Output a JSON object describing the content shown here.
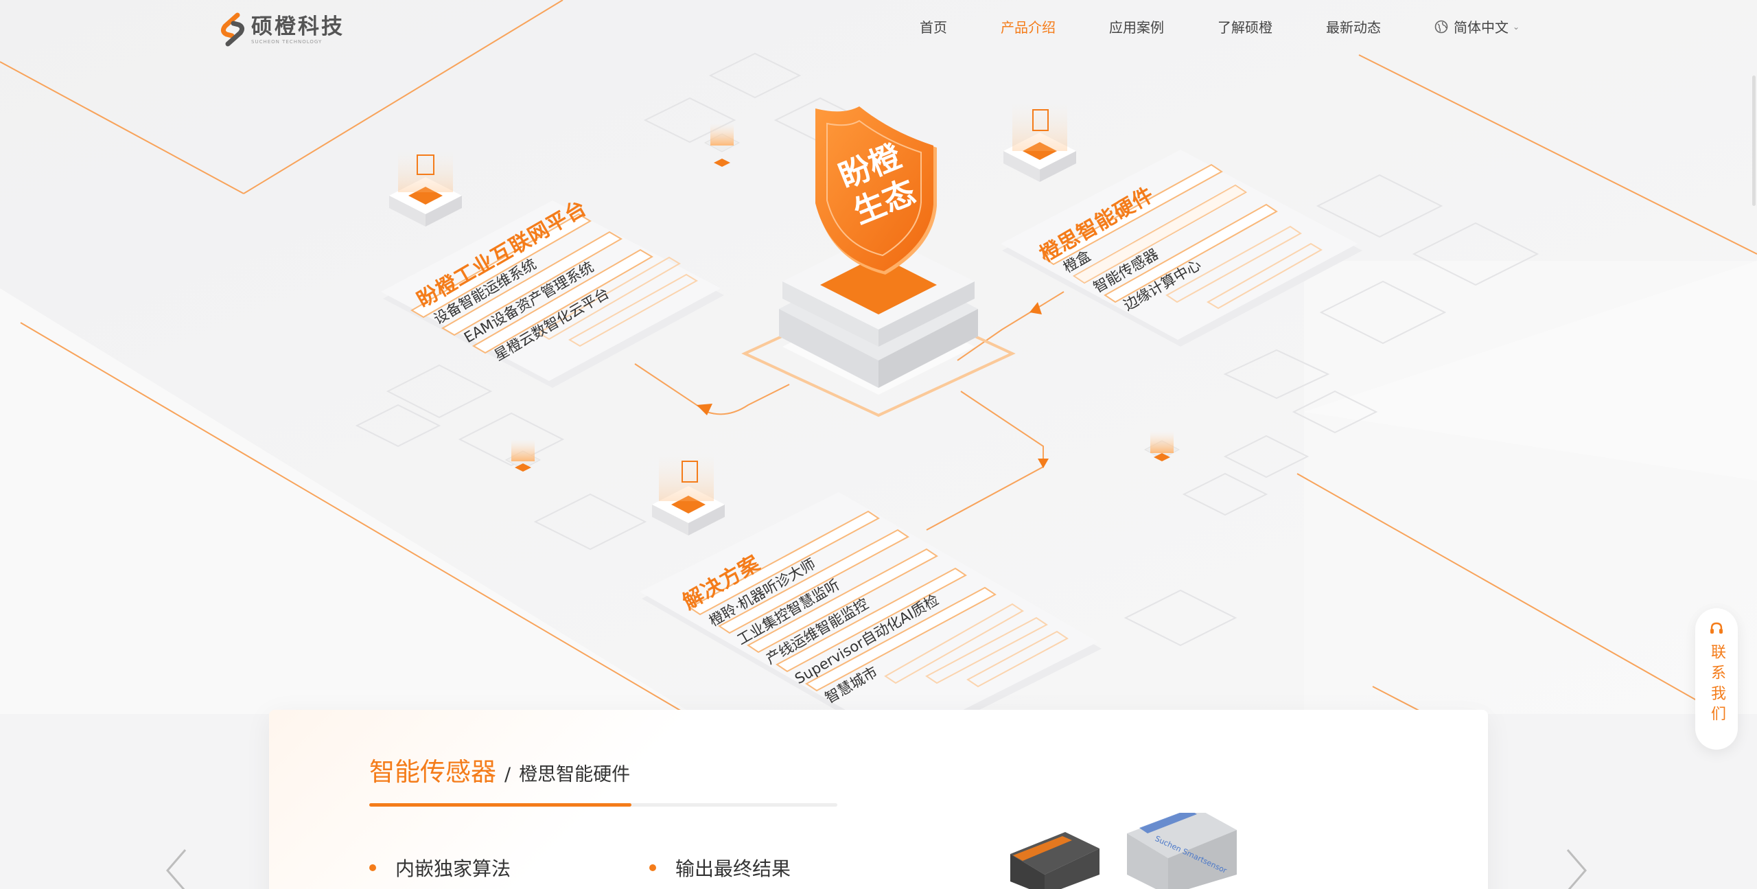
{
  "brand": {
    "name": "硕橙科技",
    "tagline": "SUCHEON TECHNOLOGY"
  },
  "nav": {
    "items": [
      {
        "label": "首页",
        "active": false
      },
      {
        "label": "产品介绍",
        "active": true
      },
      {
        "label": "应用案例",
        "active": false
      },
      {
        "label": "了解硕橙",
        "active": false
      },
      {
        "label": "最新动态",
        "active": false
      }
    ],
    "language": "简体中文",
    "accent_color": "#f47c1a"
  },
  "diagram": {
    "center": {
      "line1": "盼橙",
      "line2": "生态"
    },
    "platform": {
      "title": "盼橙工业互联网平台",
      "items": [
        "设备智能运维系统",
        "EAM设备资产管理系统",
        "星橙云数智化云平台"
      ]
    },
    "hardware": {
      "title": "橙思智能硬件",
      "items": [
        "橙盒",
        "智能传感器",
        "边缘计算中心"
      ]
    },
    "solutions": {
      "title": "解决方案",
      "items": [
        "橙聆·机器听诊大师",
        "工业集控智慧监听",
        "产线运维智能监控",
        "Supervisor自动化AI质检",
        "智慧城市"
      ]
    }
  },
  "product": {
    "title": "智能传感器",
    "separator": "/",
    "category": "橙思智能硬件",
    "progress": 0.56,
    "features": [
      "内嵌独家算法",
      "输出最终结果"
    ],
    "device_label": "Suchen Smartsensor"
  },
  "contact": {
    "label": "联系我们"
  }
}
